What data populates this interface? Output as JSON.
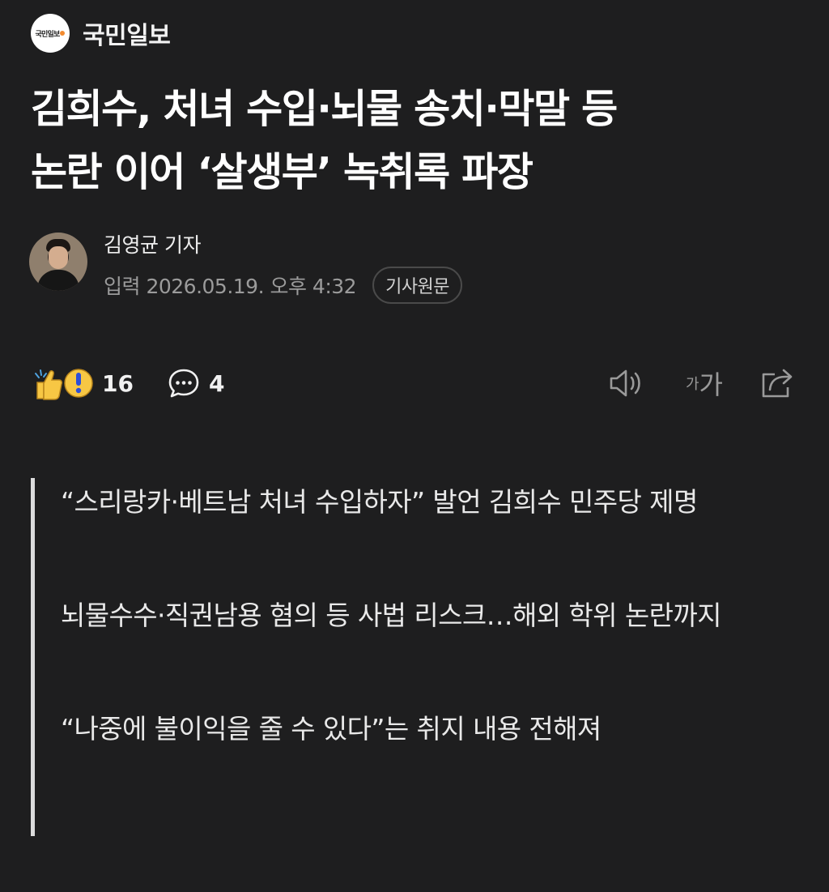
{
  "publisher": {
    "logo_text": "국민일보",
    "name": "국민일보",
    "accent_color": "#f28b30"
  },
  "headline": {
    "lines": [
      "김희수, 처녀 수입·뇌물 송치·막말 등",
      "논란 이어 ‘살생부’ 녹취록 파장"
    ]
  },
  "byline": {
    "reporter": "김영균 기자",
    "published": "입력 2026.05.19. 오후 4:32",
    "source_button": "기사원문"
  },
  "actions": {
    "reaction_icons": [
      "thumbs-up-icon",
      "surprised-icon"
    ],
    "reaction_count": "16",
    "comment_icon": "comment-bubble-icon",
    "comment_count": "4",
    "listen_icon": "speaker-icon",
    "font_size_small": "가",
    "font_size_large": "가",
    "share_icon": "share-icon"
  },
  "summary": {
    "items": [
      "“스리랑카·베트남 처녀 수입하자” 발언 김희수 민주당 제명",
      "뇌물수수·직권남용 혐의 등 사법 리스크…해외 학위 논란까지",
      "“나중에 불이익을 줄 수 있다”는 취지 내용 전해져"
    ]
  },
  "colors": {
    "background": "#1e1e1f",
    "text_primary": "#ffffff",
    "text_secondary": "#9b9b9b",
    "quote_bar": "#dcdcdc",
    "emoji_yellow": "#f7c744"
  }
}
